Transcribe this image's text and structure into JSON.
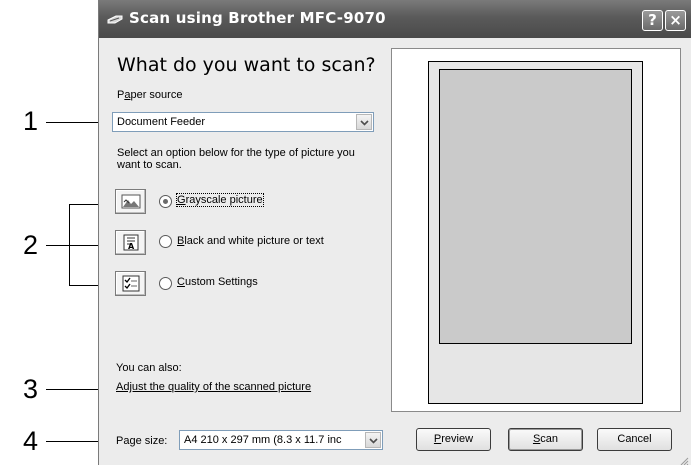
{
  "callouts": {
    "c1": "1",
    "c2": "2",
    "c3": "3",
    "c4": "4"
  },
  "window": {
    "title": "Scan using Brother MFC-9070",
    "help_glyph": "?",
    "close_glyph": "×"
  },
  "heading": "What do you want to scan?",
  "paper_source": {
    "label_prefix": "P",
    "label_access": "a",
    "label_suffix": "per source",
    "value": "Document Feeder"
  },
  "instructions": "Select an option below for the type of picture you want to scan.",
  "options": [
    {
      "access": "G",
      "rest": "rayscale picture",
      "icon": "grayscale-picture-icon",
      "selected": true
    },
    {
      "access": "B",
      "rest": "lack and white picture or text",
      "icon": "text-picture-icon",
      "selected": false
    },
    {
      "access": "C",
      "rest": "ustom Settings",
      "icon": "custom-settings-icon",
      "selected": false
    }
  ],
  "also": {
    "label": "You can also:",
    "link": "Adjust the quality of the scanned picture"
  },
  "page_size": {
    "label": "Page size:",
    "value": "A4 210 x 297 mm (8.3 x 11.7 inc"
  },
  "buttons": {
    "preview_access": "P",
    "preview_rest": "review",
    "scan_access": "S",
    "scan_rest": "can",
    "cancel": "Cancel"
  },
  "colors": {
    "titlebar": "#5a5a5a",
    "dialog_bg": "#ececec",
    "preview_scan": "#cacaca",
    "preview_page": "#e6e6e6"
  }
}
